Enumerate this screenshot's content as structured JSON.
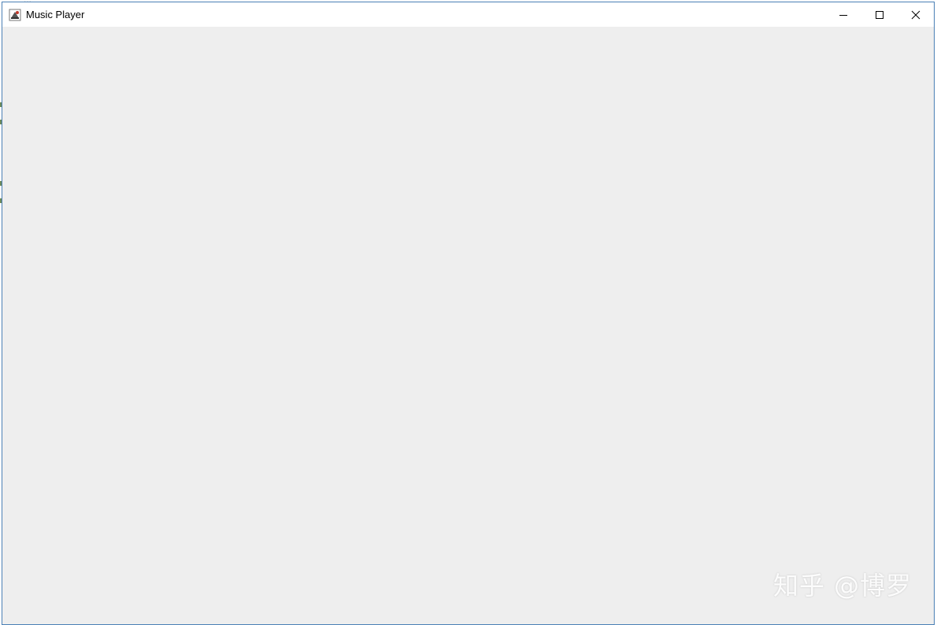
{
  "background": {
    "partial_text": "..."
  },
  "window": {
    "title": "Music Player",
    "app_icon": "java-coffee-cup-icon",
    "controls": {
      "minimize": "minimize-icon",
      "maximize": "maximize-icon",
      "close": "close-icon"
    },
    "content_background": "#eeeeee",
    "border_color": "#4a7fb5"
  },
  "watermark": {
    "text": "知乎 @博罗"
  }
}
